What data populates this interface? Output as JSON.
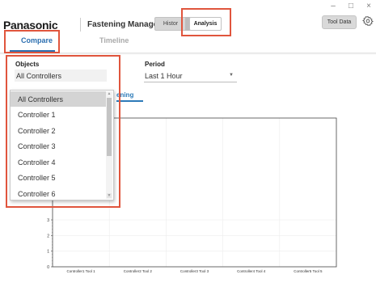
{
  "window": {
    "minimize_glyph": "–",
    "maximize_glyph": "□",
    "close_glyph": "×"
  },
  "header": {
    "brand": "Panasonic",
    "app_title": "Fastening Manager",
    "mode_history": "Histor",
    "mode_analysis": "Analysis",
    "tool_data_label": "Tool Data",
    "settings_icon": "gear-icon"
  },
  "tabs": [
    {
      "label": "Compare",
      "active": true
    },
    {
      "label": "Timeline",
      "active": false
    }
  ],
  "filters": {
    "objects_label": "Objects",
    "objects_value": "All Controllers",
    "period_label": "Period",
    "period_value": "Last 1 Hour"
  },
  "subtab_fragment": "ening",
  "dropdown": {
    "options": [
      "All Controllers",
      "Controller 1",
      "Controller 2",
      "Controller 3",
      "Controller 4",
      "Controller 5",
      "Controller 6"
    ],
    "selected": "All Controllers"
  },
  "annotation_color": "#e0553d",
  "accent_color": "#2c6fb0",
  "chart_data": {
    "type": "bar",
    "categories": [
      "Controller1 Tool 1",
      "Controller2 Tool 2",
      "Controller3 Tool 3",
      "Controller4 Tool 4",
      "Controller5 Tool 5"
    ],
    "values": [
      0,
      0,
      0,
      0,
      0
    ],
    "yticks": [
      "0",
      "1",
      "2",
      "3"
    ],
    "ylim": [
      0,
      3
    ],
    "grid": true
  }
}
